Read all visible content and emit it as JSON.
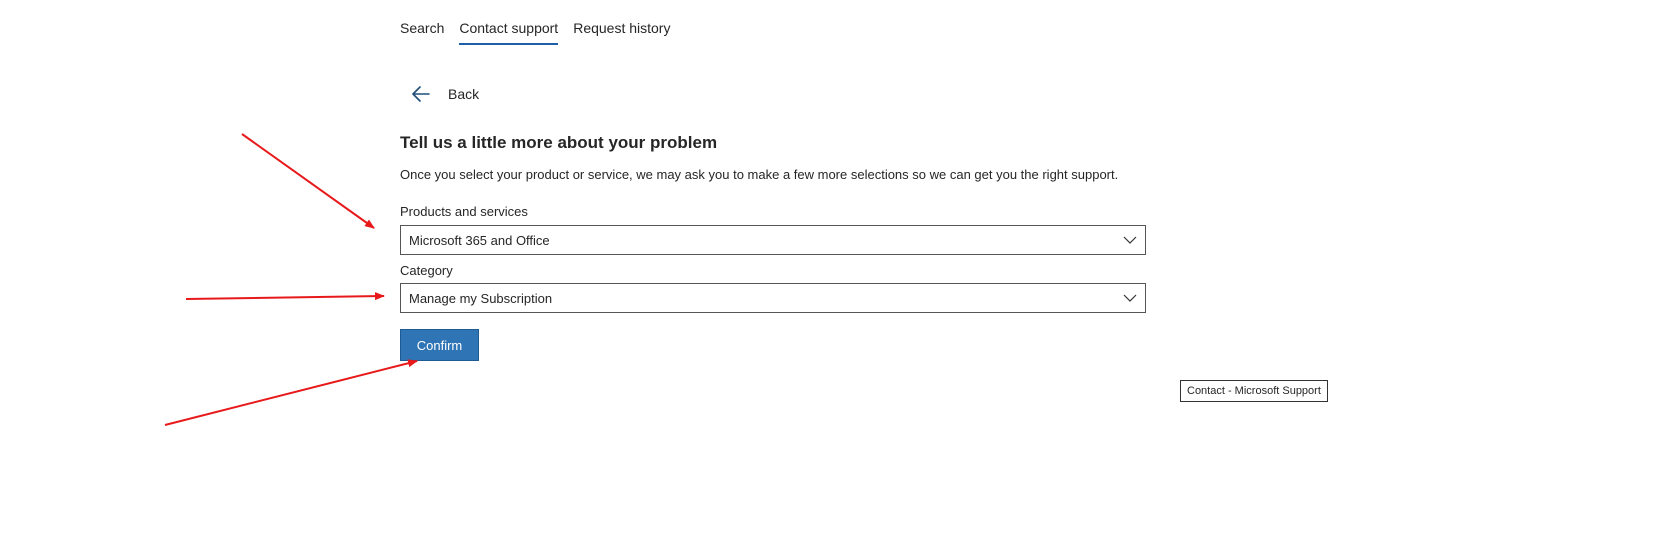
{
  "tabs": [
    {
      "label": "Search",
      "active": false
    },
    {
      "label": "Contact support",
      "active": true
    },
    {
      "label": "Request history",
      "active": false
    }
  ],
  "back": {
    "label": "Back",
    "icon": "arrow-left-icon"
  },
  "form": {
    "title": "Tell us a little more about your problem",
    "description": "Once you select your product or service, we may ask you to make a few more selections so we can get you the right support.",
    "products_label": "Products and services",
    "products_value": "Microsoft 365 and Office",
    "category_label": "Category",
    "category_value": "Manage my Subscription",
    "confirm_label": "Confirm"
  },
  "tooltip": {
    "text": "Contact - Microsoft Support"
  },
  "colors": {
    "accent": "#2f74b5",
    "tab_underline": "#1f5fa8",
    "annotation_arrow": "#e8191a"
  }
}
